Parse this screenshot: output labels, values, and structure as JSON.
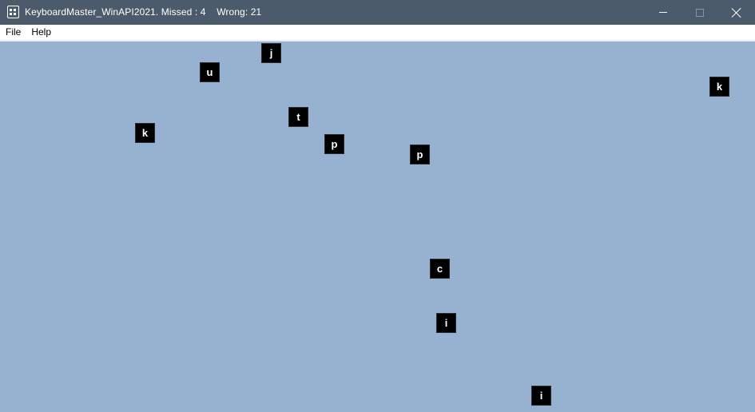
{
  "window": {
    "title": "KeyboardMaster_WinAPI2021. Missed : 4    Wrong: 21",
    "icon": "building-icon"
  },
  "menu": {
    "items": [
      "File",
      "Help"
    ]
  },
  "game": {
    "background_color": "#97b2d1",
    "letters": [
      "j",
      "u",
      "k",
      "t",
      "k",
      "p",
      "p",
      "c",
      "i",
      "i"
    ]
  }
}
